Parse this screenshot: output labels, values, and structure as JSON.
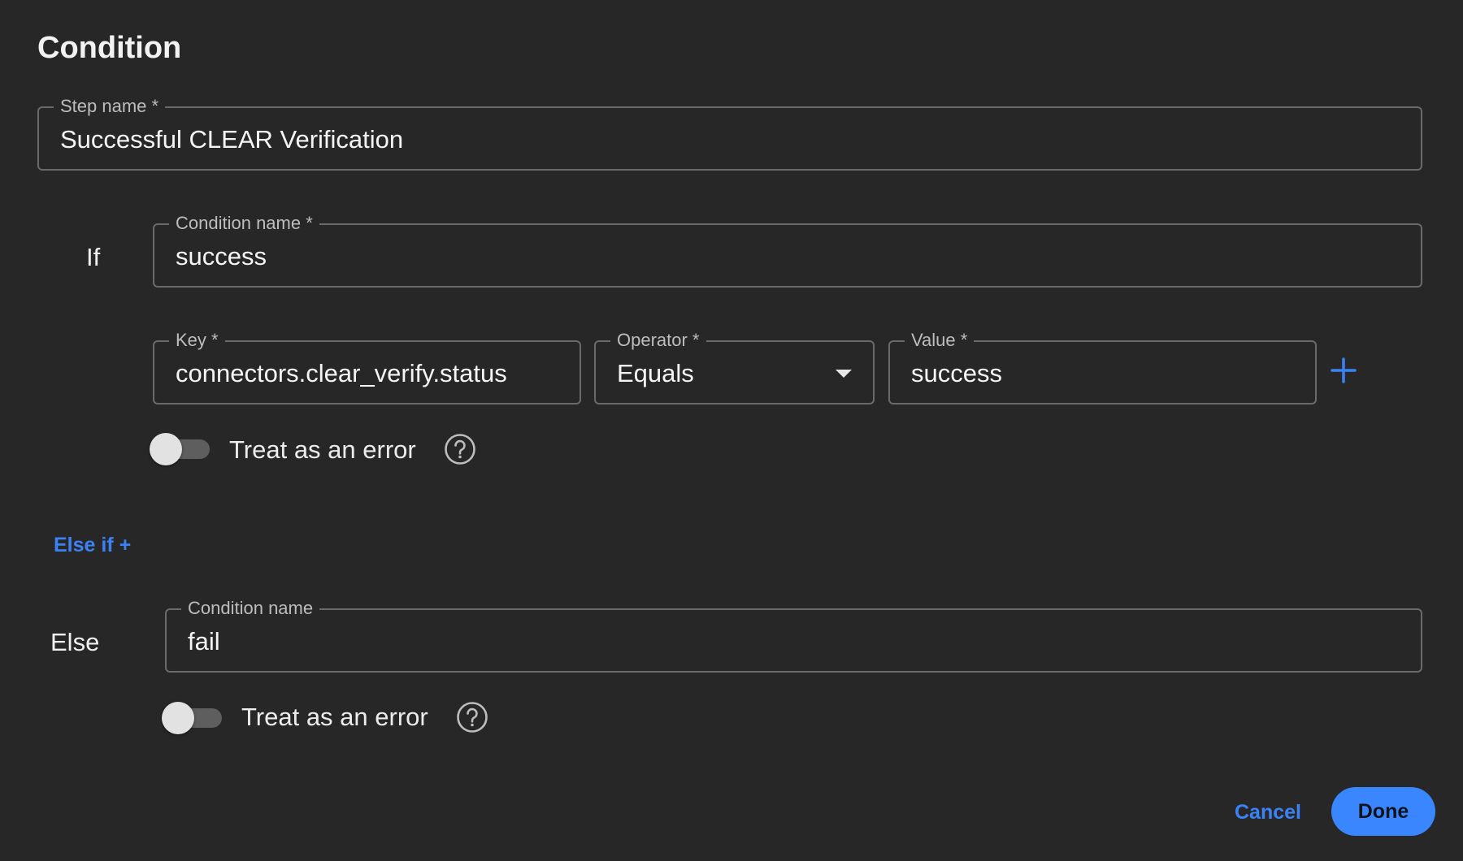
{
  "dialog": {
    "title": "Condition"
  },
  "step_name": {
    "label": "Step name *",
    "value": "Successful CLEAR Verification"
  },
  "if_block": {
    "label": "If",
    "condition_name": {
      "label": "Condition name *",
      "value": "success"
    },
    "key": {
      "label": "Key *",
      "value": "connectors.clear_verify.status"
    },
    "operator": {
      "label": "Operator *",
      "value": "Equals"
    },
    "value": {
      "label": "Value *",
      "value": "success"
    },
    "treat_as_error": {
      "label": "Treat as an error",
      "checked": false
    }
  },
  "else_if": {
    "label": "Else if +"
  },
  "else_block": {
    "label": "Else",
    "condition_name": {
      "label": "Condition name",
      "value": "fail"
    },
    "treat_as_error": {
      "label": "Treat as an error",
      "checked": false
    }
  },
  "actions": {
    "cancel_label": "Cancel",
    "done_label": "Done"
  },
  "colors": {
    "background": "#272727",
    "accent": "#3a86ff",
    "link": "#3b82f6",
    "border": "#6a6a6a"
  },
  "icons": {
    "help": "help-circle-icon",
    "add": "plus-icon",
    "dropdown": "caret-down-icon"
  }
}
